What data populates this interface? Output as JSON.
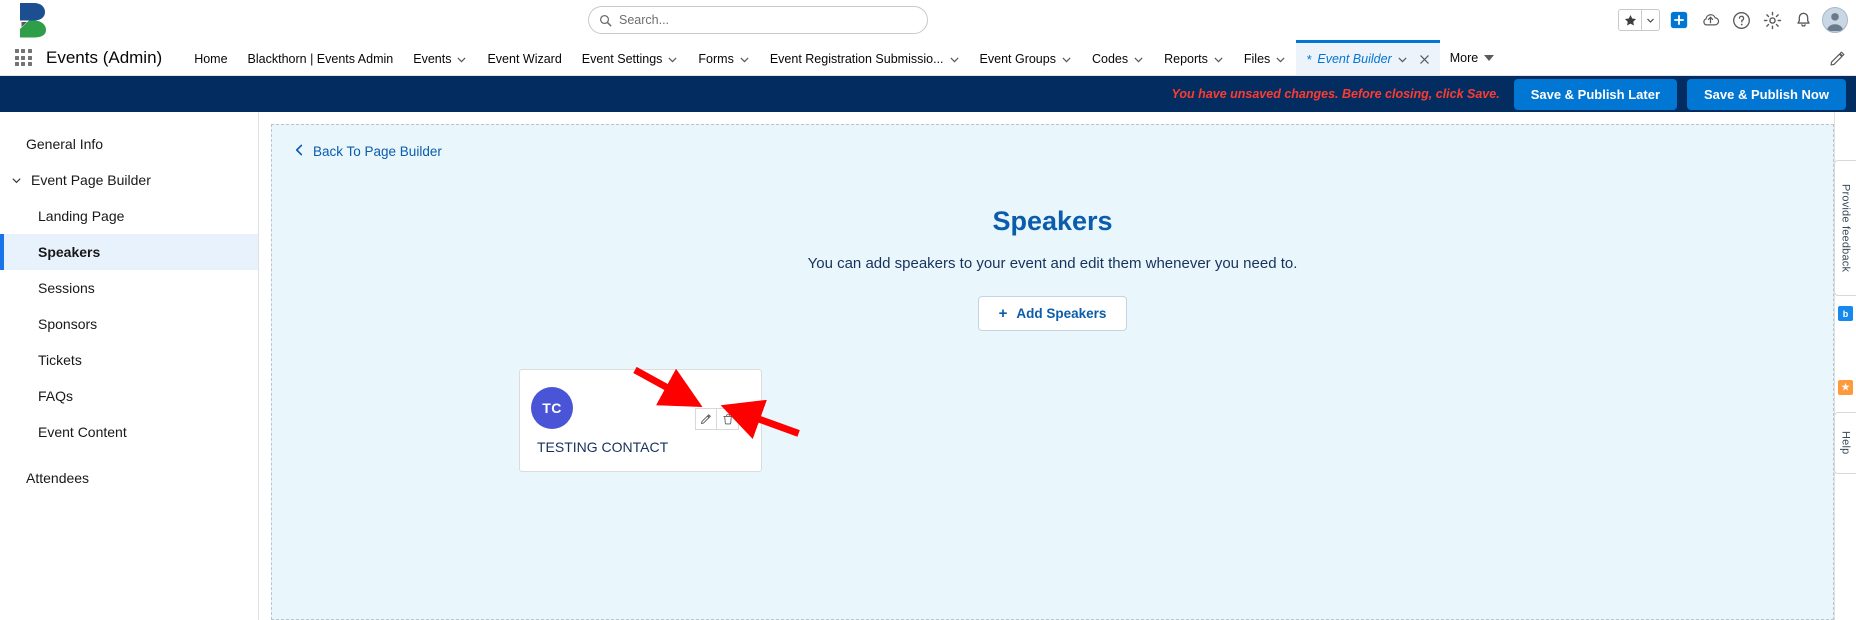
{
  "header": {
    "logo_alt": "blackthorn-logo",
    "search": {
      "placeholder": "Search...",
      "value": ""
    },
    "icons": [
      "favorites-star-icon",
      "favorites-caret-icon",
      "add-icon",
      "cloud-icon",
      "help-icon",
      "setup-gear-icon",
      "notifications-bell-icon",
      "user-avatar"
    ]
  },
  "appnav": {
    "waffle_label": "app-launcher",
    "app_name": "Events (Admin)",
    "items": [
      {
        "label": "Home",
        "caret": false
      },
      {
        "label": "Blackthorn | Events Admin",
        "caret": false
      },
      {
        "label": "Events",
        "caret": true
      },
      {
        "label": "Event Wizard",
        "caret": false
      },
      {
        "label": "Event Settings",
        "caret": true
      },
      {
        "label": "Forms",
        "caret": true
      },
      {
        "label": "Event Registration Submissio...",
        "caret": true
      },
      {
        "label": "Event Groups",
        "caret": true
      },
      {
        "label": "Codes",
        "caret": true
      },
      {
        "label": "Reports",
        "caret": true
      },
      {
        "label": "Files",
        "caret": true
      }
    ],
    "active_tab": {
      "dirty_marker": "*",
      "label": "Event Builder",
      "caret": true,
      "close": "close-icon"
    },
    "more_label": "More",
    "edit_pencil": "pencil-icon"
  },
  "banner": {
    "message": "You have unsaved changes. Before closing, click Save.",
    "save_later_label": "Save & Publish Later",
    "save_now_label": "Save & Publish Now",
    "background_color": "#032d60",
    "message_color": "#ff3b30",
    "button_color": "#0176d3"
  },
  "sidebar": {
    "items": [
      {
        "label": "General Info",
        "level": "top",
        "active": false,
        "chevron": false
      },
      {
        "label": "Event Page Builder",
        "level": "group",
        "active": false,
        "chevron": true
      },
      {
        "label": "Landing Page",
        "level": "child",
        "active": false,
        "chevron": false
      },
      {
        "label": "Speakers",
        "level": "child",
        "active": true,
        "chevron": false
      },
      {
        "label": "Sessions",
        "level": "child",
        "active": false,
        "chevron": false
      },
      {
        "label": "Sponsors",
        "level": "child",
        "active": false,
        "chevron": false
      },
      {
        "label": "Tickets",
        "level": "child",
        "active": false,
        "chevron": false
      },
      {
        "label": "FAQs",
        "level": "child",
        "active": false,
        "chevron": false
      },
      {
        "label": "Event Content",
        "level": "child",
        "active": false,
        "chevron": false
      },
      {
        "label": "Attendees",
        "level": "top",
        "active": false,
        "chevron": false
      }
    ],
    "active_accent": "#1a73e8"
  },
  "main": {
    "back_link": "Back To Page Builder",
    "title": "Speakers",
    "title_color": "#0b5cab",
    "description": "You can add speakers to your event and edit them whenever you need to.",
    "add_button": {
      "label": "Add Speakers",
      "icon": "plus-icon"
    },
    "speaker_card": {
      "initials": "TC",
      "name": "TESTING CONTACT",
      "avatar_color": "#4a54d6",
      "edit_icon": "pencil-icon",
      "delete_icon": "trash-icon"
    },
    "annotations": [
      {
        "name": "arrow-to-edit-button",
        "color": "#ff0000"
      },
      {
        "name": "arrow-to-delete-button",
        "color": "#ff0000"
      }
    ]
  },
  "right_rail": {
    "feedback_label": "Provide feedback",
    "help_label": "Help",
    "badge_blue": "badge-blue-icon",
    "badge_orange": "badge-orange-icon"
  }
}
